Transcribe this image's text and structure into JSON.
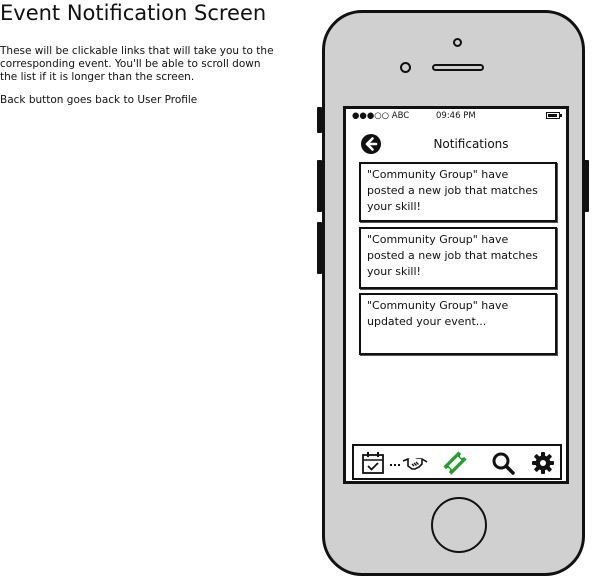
{
  "page": {
    "title": "Event Notification Screen",
    "description": [
      "These will be clickable links that will take you to the corresponding event. You'll be able to scroll down the list if it is longer than the screen.",
      "Back button goes back to User Profile"
    ]
  },
  "status_bar": {
    "carrier": "●●●○○ ABC",
    "time": "09:46 PM"
  },
  "screen": {
    "title": "Notifications"
  },
  "notifications": [
    {
      "text": "\"Community Group\" have posted a new job that matches your skill!"
    },
    {
      "text": "\"Community Group\" have posted a new job that matches your skill!"
    },
    {
      "text": "\"Community Group\" have updated your event..."
    }
  ],
  "tabbar": {
    "icons": [
      "calendar-check-icon",
      "handshake-icon",
      "ticket-icon",
      "search-icon",
      "gear-icon"
    ],
    "colors": {
      "active": "#22a02a",
      "default": "#111111"
    }
  }
}
